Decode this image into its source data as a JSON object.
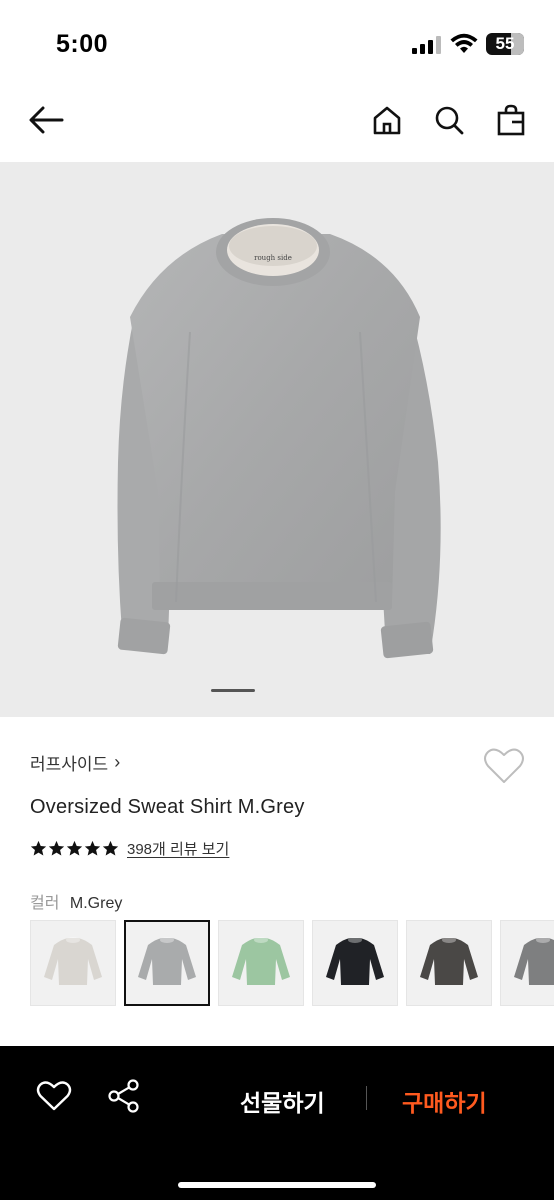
{
  "status_bar": {
    "time": "5:00",
    "battery": "55",
    "icons": [
      "signal-icon",
      "wifi-icon",
      "battery-icon"
    ]
  },
  "nav": {
    "icons": [
      "back-arrow-icon",
      "home-icon",
      "search-icon",
      "shopping-bag-icon"
    ]
  },
  "hero": {
    "image": "grey-sweatshirt-photo",
    "neck_label": "rough side"
  },
  "product": {
    "brand": "러프사이드",
    "brand_chevron": "›",
    "name": "Oversized Sweat Shirt M.Grey",
    "rating_stars": 5,
    "review_link": "398개 리뷰 보기",
    "color_label": "컬러",
    "color_value": "M.Grey",
    "swatches": [
      {
        "name": "oatmeal",
        "color": "#d9d6d1",
        "selected": false
      },
      {
        "name": "m-grey",
        "color": "#a9abac",
        "selected": true
      },
      {
        "name": "green",
        "color": "#9cc6a1",
        "selected": false
      },
      {
        "name": "black",
        "color": "#202226",
        "selected": false
      },
      {
        "name": "charcoal",
        "color": "#4a4846",
        "selected": false
      },
      {
        "name": "grey-partial",
        "color": "#7e7f80",
        "selected": false
      }
    ]
  },
  "bottom_bar": {
    "gift_label": "선물하기",
    "buy_label": "구매하기",
    "buy_color": "#ff5a1f",
    "icons": [
      "heart-icon",
      "share-icon"
    ]
  }
}
